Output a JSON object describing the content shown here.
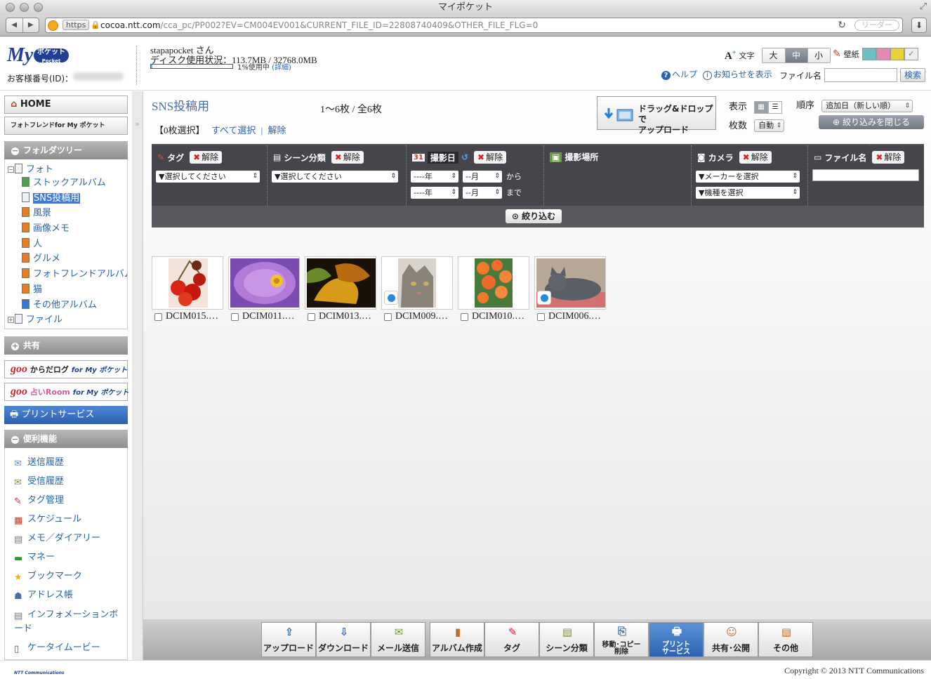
{
  "window": {
    "title": "マイポケット"
  },
  "browser": {
    "https_label": "https",
    "url_host": "cocoa.ntt.com",
    "url_path": "/cca_pc/PP002?EV=CM004EV001&CURRENT_FILE_ID=22808740409&OTHER_FILE_FLG=0",
    "reader_label": "リーダー"
  },
  "header": {
    "logo_text": "My",
    "logo_badge": "ポケット",
    "logo_sub": "Pocket",
    "customer_id_label": "お客様番号(ID)：",
    "username": "stapapocket さん",
    "disk_usage": "ディスク使用状況：113.7MB / 32768.0MB",
    "disk_percent": "1%使用中",
    "disk_used_fraction": 0.01,
    "disk_detail_link": "(詳細)",
    "text_size_label": "文字",
    "size_large": "大",
    "size_medium": "中",
    "size_small": "小",
    "wallpaper_label": "壁紙",
    "wallpaper_colors": [
      "#6ec0c4",
      "#e58ab0",
      "#e8d23a"
    ],
    "help_link": "ヘルプ",
    "notice_link": "お知らせを表示",
    "filename_label": "ファイル名",
    "search_button": "検索"
  },
  "sidebar": {
    "home": "HOME",
    "photofriend": "フォトフレンドfor My ポケット",
    "folder_tree_heading": "フォルダツリー",
    "tree": [
      {
        "label": "フォト"
      },
      {
        "label": "ストックアルバム"
      },
      {
        "label": "SNS投稿用"
      },
      {
        "label": "風景"
      },
      {
        "label": "画像メモ"
      },
      {
        "label": "人"
      },
      {
        "label": "グルメ"
      },
      {
        "label": "フォトフレンドアルバム"
      },
      {
        "label": "猫"
      },
      {
        "label": "その他アルバム"
      },
      {
        "label": "ファイル"
      }
    ],
    "share_heading": "共有",
    "banner_karada": "からだログ",
    "banner_uranai": "占いRoom",
    "banner_goo": "goo",
    "banner_for": "for My ポケット",
    "print_service": "プリントサービス",
    "features_heading": "便利機能",
    "features": [
      {
        "label": "送信履歴"
      },
      {
        "label": "受信履歴"
      },
      {
        "label": "タグ管理"
      },
      {
        "label": "スケジュール"
      },
      {
        "label": "メモ／ダイアリー"
      },
      {
        "label": "マネー"
      },
      {
        "label": "ブックマーク"
      },
      {
        "label": "アドレス帳"
      },
      {
        "label": "インフォメーションボード"
      },
      {
        "label": "ケータイムービー"
      }
    ]
  },
  "main": {
    "folder_title": "SNS投稿用",
    "count_label": "1〜6枚 / 全6枚",
    "selected_label": "【0枚選択】",
    "select_all": "すべて選択",
    "separator": "|",
    "deselect": "解除",
    "dragdrop_line1": "ドラッグ&ドロップで",
    "dragdrop_line2": "アップロード",
    "view_label": "表示",
    "count_per_page_label": "枚数",
    "count_per_page_value": "自動",
    "order_label": "順序",
    "order_value": "追加日（新しい順）",
    "close_filter": "絞り込みを閉じる"
  },
  "filter": {
    "clear": "解除",
    "tag_label": "タグ",
    "tag_select": "▼選択してください",
    "scene_label": "シーン分類",
    "scene_select": "▼選択してください",
    "date_label": "撮影日",
    "year_placeholder": "----年",
    "month_placeholder": "--月",
    "from_label": "から",
    "to_label": "まで",
    "location_label": "撮影場所",
    "camera_label": "カメラ",
    "maker_select": "▼メーカーを選択",
    "model_select": "▼機種を選択",
    "filename_label": "ファイル名",
    "narrow_button": "絞り込む"
  },
  "thumbnails": [
    {
      "name": "DCIM015.…"
    },
    {
      "name": "DCIM011.…"
    },
    {
      "name": "DCIM013.…"
    },
    {
      "name": "DCIM009.…"
    },
    {
      "name": "DCIM010.…"
    },
    {
      "name": "DCIM006.…"
    }
  ],
  "actions": [
    {
      "label": "アップロード"
    },
    {
      "label": "ダウンロード"
    },
    {
      "label": "メール送信"
    },
    {
      "label": "アルバム作成"
    },
    {
      "label": "タグ"
    },
    {
      "label": "シーン分類"
    },
    {
      "label": "移動･コピー",
      "label2": "削除"
    },
    {
      "label": "プリント",
      "label2": "サービス"
    },
    {
      "label": "共有･公開"
    },
    {
      "label": "その他"
    }
  ],
  "footer": {
    "copyright": "Copyright © 2013 NTT Communications",
    "logo_text": "NTT Communications"
  },
  "colors": {
    "accent": "#2a62b0",
    "filter_bg": "#45454b",
    "print_blue": "#2c5fb0"
  }
}
